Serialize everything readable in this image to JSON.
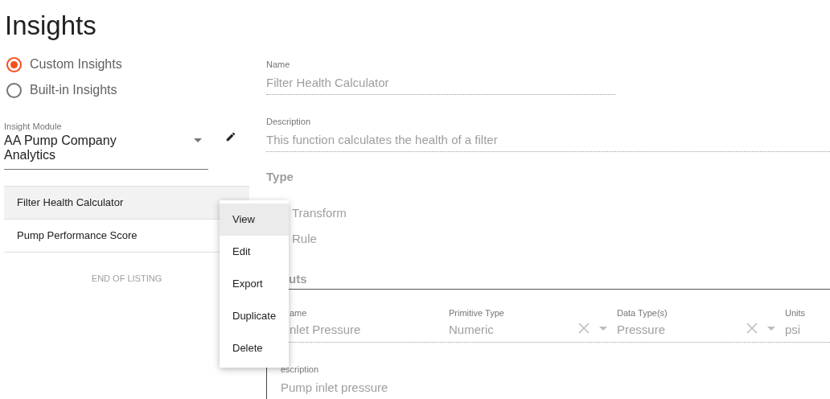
{
  "page": {
    "title": "Insights"
  },
  "insight_source": [
    {
      "label": "Custom Insights",
      "selected": true
    },
    {
      "label": "Built-in Insights",
      "selected": false
    }
  ],
  "module_select": {
    "label": "Insight Module",
    "value": "AA Pump Company Analytics"
  },
  "insights": [
    {
      "name": "Filter Health Calculator",
      "selected": true
    },
    {
      "name": "Pump Performance Score",
      "selected": false
    }
  ],
  "end_note": "END OF LISTING",
  "context_menu": [
    {
      "label": "View",
      "selected": true
    },
    {
      "label": "Edit",
      "selected": false
    },
    {
      "label": "Export",
      "selected": false
    },
    {
      "label": "Duplicate",
      "selected": false
    },
    {
      "label": "Delete",
      "selected": false
    }
  ],
  "detail": {
    "name": {
      "label": "Name",
      "value": "Filter Health Calculator"
    },
    "description": {
      "label": "Description",
      "value": "This function calculates the health of a filter"
    },
    "type": {
      "heading": "Type",
      "options": [
        {
          "label": "Transform"
        },
        {
          "label": "Rule"
        }
      ]
    },
    "inputs": {
      "heading": "uts",
      "fields": [
        {
          "label": "ame",
          "value": "nlet Pressure",
          "kind": "text"
        },
        {
          "label": "Primitive Type",
          "value": "Numeric",
          "kind": "select"
        },
        {
          "label": "Data Type(s)",
          "value": "Pressure",
          "kind": "select"
        },
        {
          "label": "Units",
          "value": "psi",
          "kind": "text"
        }
      ],
      "description": {
        "label": "escription",
        "value": "Pump inlet pressure"
      }
    }
  }
}
